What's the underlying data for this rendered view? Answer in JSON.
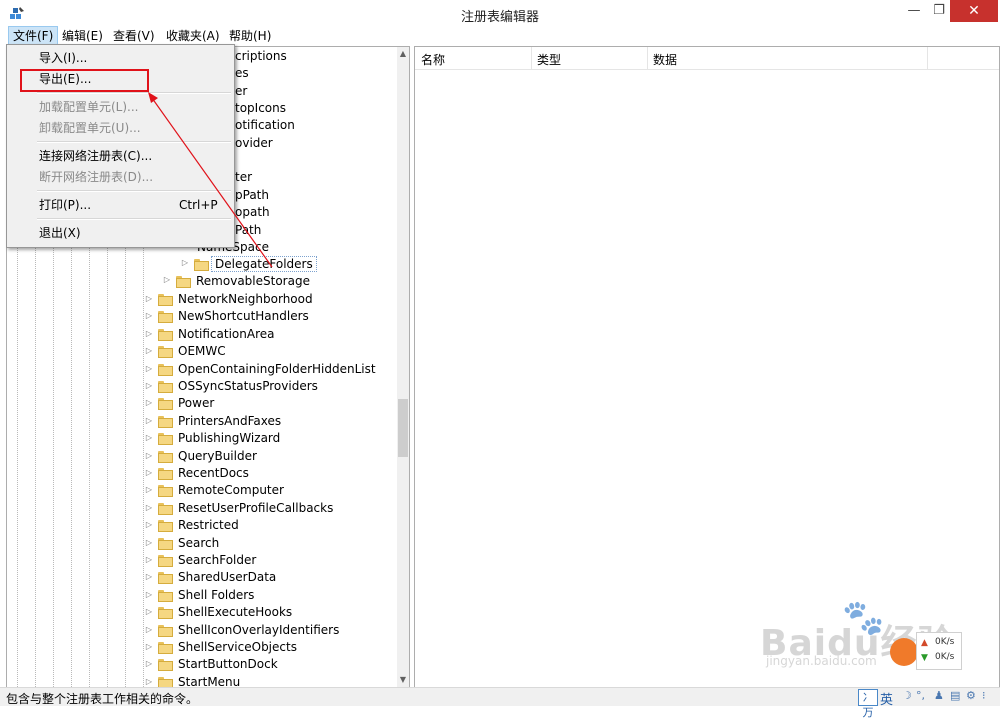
{
  "window": {
    "title": "注册表编辑器",
    "min_glyph": "—",
    "max_glyph": "❐",
    "close_glyph": "✕"
  },
  "menubar": {
    "items": [
      "文件(F)",
      "编辑(E)",
      "查看(V)",
      "收藏夹(A)",
      "帮助(H)"
    ]
  },
  "file_menu": {
    "items": [
      {
        "label": "导入(I)...",
        "enabled": true
      },
      {
        "label": "导出(E)...",
        "enabled": true
      },
      {
        "label": "加载配置单元(L)...",
        "enabled": false
      },
      {
        "label": "卸载配置单元(U)...",
        "enabled": false
      },
      {
        "label": "连接网络注册表(C)...",
        "enabled": true
      },
      {
        "label": "断开网络注册表(D)...",
        "enabled": false
      },
      {
        "label": "打印(P)...",
        "enabled": true,
        "shortcut": "Ctrl+P"
      },
      {
        "label": "退出(X)",
        "enabled": true
      }
    ]
  },
  "tree": {
    "partial_rows": [
      "criptions",
      "es",
      "er",
      "topIcons",
      "otification",
      "ovider",
      "ter",
      "pPath",
      "opath",
      "Path",
      "NameSpace"
    ],
    "subitems": [
      "DelegateFolders",
      "RemovableStorage"
    ],
    "items": [
      "NetworkNeighborhood",
      "NewShortcutHandlers",
      "NotificationArea",
      "OEMWC",
      "OpenContainingFolderHiddenList",
      "OSSyncStatusProviders",
      "Power",
      "PrintersAndFaxes",
      "PublishingWizard",
      "QueryBuilder",
      "RecentDocs",
      "RemoteComputer",
      "ResetUserProfileCallbacks",
      "Restricted",
      "Search",
      "SearchFolder",
      "SharedUserData",
      "Shell Folders",
      "ShellExecuteHooks",
      "ShellIconOverlayIdentifiers",
      "ShellServiceObjects",
      "StartButtonDock",
      "StartMenu"
    ]
  },
  "list": {
    "columns": [
      "名称",
      "类型",
      "数据"
    ]
  },
  "status": {
    "text": "包含与整个注册表工作相关的命令。"
  },
  "tray": {
    "ime": "冫万",
    "lang": "英"
  },
  "netmon": {
    "up": "0K/s",
    "down": "0K/s"
  },
  "watermark": {
    "main": "Baidu经验",
    "sub": "jingyan.baidu.com"
  },
  "colors": {
    "highlight_box": "#e0121a",
    "close_button": "#c7312d",
    "menu_active": "#cce4f7"
  }
}
